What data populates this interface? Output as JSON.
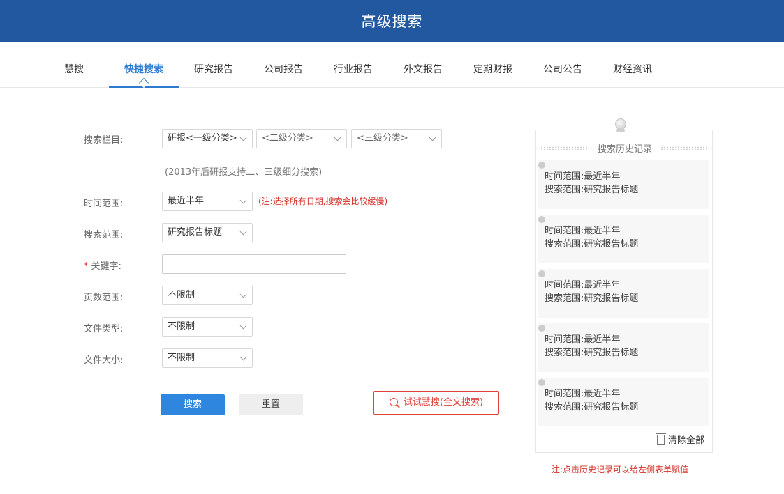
{
  "header": {
    "title": "高级搜索"
  },
  "tabs": [
    {
      "label": "慧搜"
    },
    {
      "label": "快捷搜索"
    },
    {
      "label": "研究报告"
    },
    {
      "label": "公司报告"
    },
    {
      "label": "行业报告"
    },
    {
      "label": "外文报告"
    },
    {
      "label": "定期财报"
    },
    {
      "label": "公司公告"
    },
    {
      "label": "财经资讯"
    }
  ],
  "form": {
    "column_label": "搜索栏目:",
    "column_selects": [
      "研报<一级分类>",
      "<二级分类>",
      "<三级分类>"
    ],
    "column_hint": "(2013年后研报支持二、三级细分搜索)",
    "time_label": "时间范围:",
    "time_value": "最近半年",
    "time_note": "(注:选择所有日期,搜索会比较缓慢)",
    "scope_label": "搜索范围:",
    "scope_value": "研究报告标题",
    "keyword_star": "*",
    "keyword_label": "关键字:",
    "keyword_value": "",
    "pages_label": "页数范围:",
    "pages_value": "不限制",
    "filetype_label": "文件类型:",
    "filetype_value": "不限制",
    "filesize_label": "文件大小:",
    "filesize_value": "不限制",
    "search_button": "搜索",
    "reset_button": "重置",
    "try_button": "试试慧搜(全文搜索)"
  },
  "history": {
    "title": "搜索历史记录",
    "items": [
      {
        "time": "时间范围:最近半年",
        "scope": "搜索范围:研究报告标题"
      },
      {
        "time": "时间范围:最近半年",
        "scope": "搜索范围:研究报告标题"
      },
      {
        "time": "时间范围:最近半年",
        "scope": "搜索范围:研究报告标题"
      },
      {
        "time": "时间范围:最近半年",
        "scope": "搜索范围:研究报告标题"
      },
      {
        "time": "时间范围:最近半年",
        "scope": "搜索范围:研究报告标题"
      }
    ],
    "clear_label": "清除全部",
    "footnote": "注:点击历史记录可以给左侧表单赋值"
  },
  "icons": {
    "select_arrow": "chevron-down-icon",
    "try_icon": "search-icon",
    "clear_icon": "trash-icon",
    "pin_icon": "pushpin-icon"
  },
  "colors": {
    "header_bg": "#2158a0",
    "accent": "#2e7ad1",
    "primary_button": "#2e86de",
    "warning_red": "#d4322c"
  }
}
